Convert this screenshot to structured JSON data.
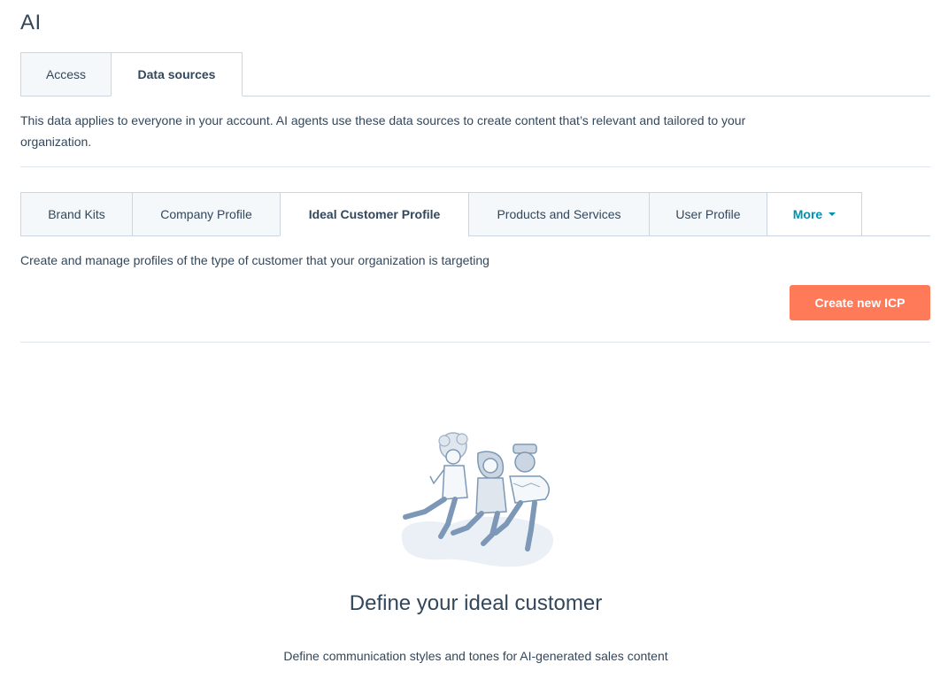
{
  "page": {
    "title": "AI"
  },
  "top_tabs": [
    {
      "label": "Access",
      "active": false
    },
    {
      "label": "Data sources",
      "active": true
    }
  ],
  "description": "This data applies to everyone in your account. AI agents use these data sources to create content that’s relevant and tailored to your organization.",
  "sub_tabs": [
    {
      "label": "Brand Kits",
      "active": false
    },
    {
      "label": "Company Profile",
      "active": false
    },
    {
      "label": "Ideal Customer Profile",
      "active": true
    },
    {
      "label": "Products and Services",
      "active": false
    },
    {
      "label": "User Profile",
      "active": false
    },
    {
      "label": "More",
      "active": false,
      "dropdown": true
    }
  ],
  "icp": {
    "description": "Create and manage profiles of the type of customer that your organization is targeting",
    "create_button_label": "Create new ICP"
  },
  "empty_state": {
    "illustration_icon": "people-walking-illustration",
    "title": "Define your ideal customer",
    "description": "Define communication styles and tones for AI-generated sales content"
  },
  "colors": {
    "primary_button": "#ff7a59",
    "link": "#0091ae",
    "text": "#33475b",
    "tab_inactive_bg": "#f5f8fa",
    "border": "#cbd6e2"
  }
}
